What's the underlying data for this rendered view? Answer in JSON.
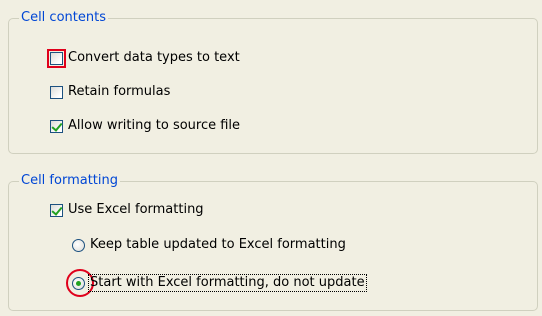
{
  "cell_contents": {
    "title": "Cell contents",
    "options": [
      {
        "label": "Convert data types to text",
        "checked": false,
        "highlighted": true
      },
      {
        "label": "Retain formulas",
        "checked": false,
        "highlighted": false
      },
      {
        "label": "Allow writing to source file",
        "checked": true,
        "highlighted": false
      }
    ]
  },
  "cell_formatting": {
    "title": "Cell formatting",
    "use_excel_formatting": {
      "label": "Use Excel formatting",
      "checked": true
    },
    "radio_options": [
      {
        "label": "Keep table updated to Excel formatting",
        "selected": false
      },
      {
        "label": "Start with Excel formatting, do not update",
        "selected": true,
        "highlighted": true
      }
    ]
  },
  "colors": {
    "group_title": "#0046d5",
    "highlight": "#e0001b",
    "check": "#21a121",
    "background": "#f1efe2"
  }
}
